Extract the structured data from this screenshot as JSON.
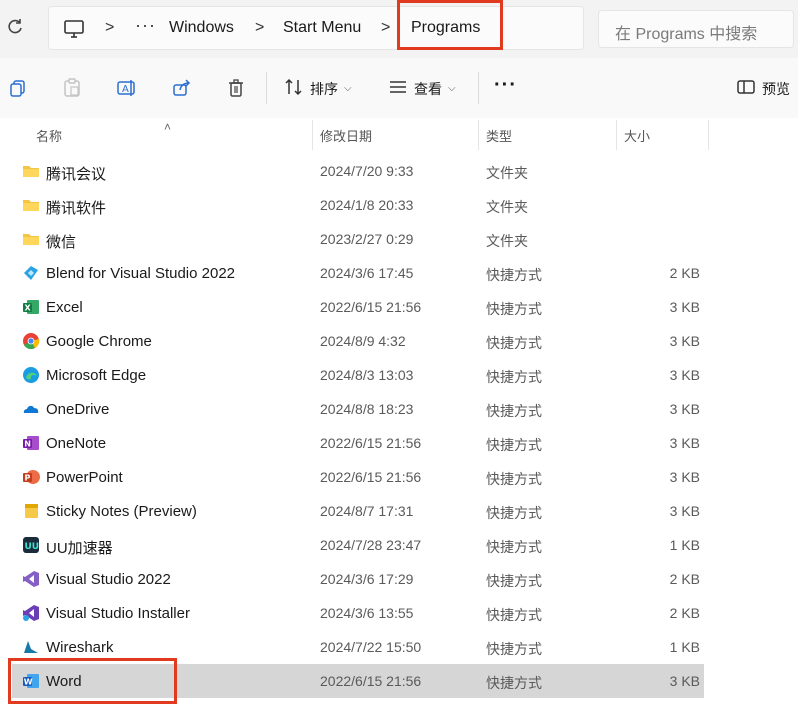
{
  "breadcrumb": {
    "overflow": "···",
    "separator": ">",
    "segments": [
      "Windows",
      "Start Menu",
      "Programs"
    ]
  },
  "search": {
    "placeholder": "在 Programs 中搜索"
  },
  "toolbar": {
    "sort_label": "排序",
    "view_label": "查看",
    "more": "···",
    "preview_label": "预览"
  },
  "columns": {
    "name": "名称",
    "modified": "修改日期",
    "type": "类型",
    "size": "大小"
  },
  "files": [
    {
      "name": "腾讯会议",
      "modified": "2024/7/20 9:33",
      "type": "文件夹",
      "size": "",
      "icon": "folder-icon"
    },
    {
      "name": "腾讯软件",
      "modified": "2024/1/8 20:33",
      "type": "文件夹",
      "size": "",
      "icon": "folder-icon"
    },
    {
      "name": "微信",
      "modified": "2023/2/27 0:29",
      "type": "文件夹",
      "size": "",
      "icon": "folder-icon"
    },
    {
      "name": "Blend for Visual Studio 2022",
      "modified": "2024/3/6 17:45",
      "type": "快捷方式",
      "size": "2 KB",
      "icon": "blend-icon"
    },
    {
      "name": "Excel",
      "modified": "2022/6/15 21:56",
      "type": "快捷方式",
      "size": "3 KB",
      "icon": "excel-icon"
    },
    {
      "name": "Google Chrome",
      "modified": "2024/8/9 4:32",
      "type": "快捷方式",
      "size": "3 KB",
      "icon": "chrome-icon"
    },
    {
      "name": "Microsoft Edge",
      "modified": "2024/8/3 13:03",
      "type": "快捷方式",
      "size": "3 KB",
      "icon": "edge-icon"
    },
    {
      "name": "OneDrive",
      "modified": "2024/8/8 18:23",
      "type": "快捷方式",
      "size": "3 KB",
      "icon": "onedrive-icon"
    },
    {
      "name": "OneNote",
      "modified": "2022/6/15 21:56",
      "type": "快捷方式",
      "size": "3 KB",
      "icon": "onenote-icon"
    },
    {
      "name": "PowerPoint",
      "modified": "2022/6/15 21:56",
      "type": "快捷方式",
      "size": "3 KB",
      "icon": "powerpoint-icon"
    },
    {
      "name": "Sticky Notes (Preview)",
      "modified": "2024/8/7 17:31",
      "type": "快捷方式",
      "size": "3 KB",
      "icon": "sticky-notes-icon"
    },
    {
      "name": "UU加速器",
      "modified": "2024/7/28 23:47",
      "type": "快捷方式",
      "size": "1 KB",
      "icon": "uu-icon"
    },
    {
      "name": "Visual Studio 2022",
      "modified": "2024/3/6 17:29",
      "type": "快捷方式",
      "size": "2 KB",
      "icon": "visual-studio-icon"
    },
    {
      "name": "Visual Studio Installer",
      "modified": "2024/3/6 13:55",
      "type": "快捷方式",
      "size": "2 KB",
      "icon": "vs-installer-icon"
    },
    {
      "name": "Wireshark",
      "modified": "2024/7/22 15:50",
      "type": "快捷方式",
      "size": "1 KB",
      "icon": "wireshark-icon"
    },
    {
      "name": "Word",
      "modified": "2022/6/15 21:56",
      "type": "快捷方式",
      "size": "3 KB",
      "icon": "word-icon"
    }
  ],
  "colors": {
    "highlight": "#e23a1e",
    "selected_row": "#d6d6d6"
  }
}
